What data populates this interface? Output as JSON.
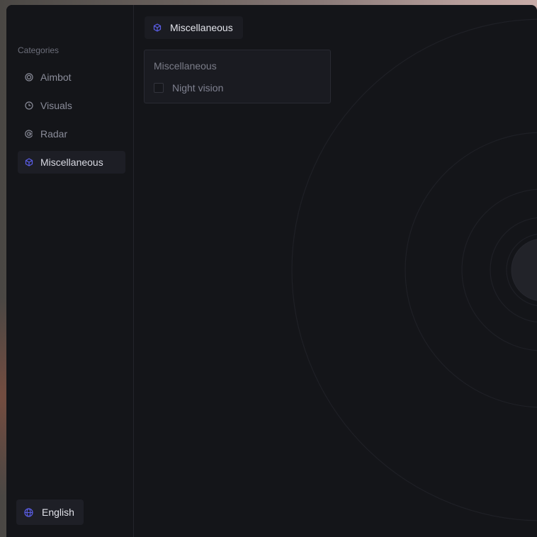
{
  "sidebar": {
    "title": "Categories",
    "items": [
      {
        "label": "Aimbot",
        "icon": "target-icon"
      },
      {
        "label": "Visuals",
        "icon": "clock-icon"
      },
      {
        "label": "Radar",
        "icon": "radar-icon"
      },
      {
        "label": "Miscellaneous",
        "icon": "cube-icon",
        "active": true
      }
    ],
    "language": {
      "label": "English",
      "icon": "globe-icon"
    }
  },
  "main": {
    "tab": {
      "label": "Miscellaneous",
      "icon": "cube-icon"
    },
    "card": {
      "title": "Miscellaneous",
      "options": [
        {
          "label": "Night vision",
          "checked": false
        }
      ]
    }
  },
  "colors": {
    "accent": "#5b5ee8",
    "background": "#141519",
    "panel": "#1a1b21"
  }
}
